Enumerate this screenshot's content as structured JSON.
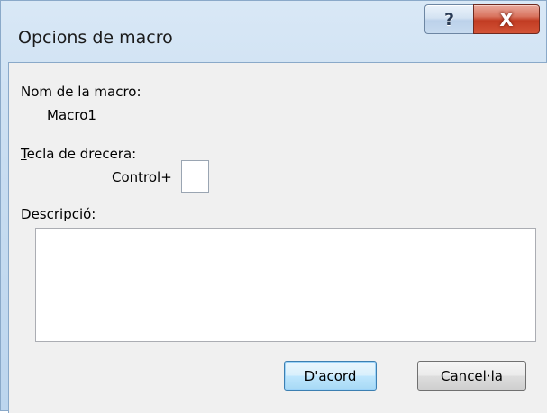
{
  "window": {
    "title": "Opcions de macro",
    "help_glyph": "?",
    "close_glyph": "X"
  },
  "form": {
    "macro_name_label": "Nom de la macro:",
    "macro_name_value": "Macro1",
    "shortcut_label_hotkey": "T",
    "shortcut_label_rest": "ecla de drecera:",
    "shortcut_prefix": "Control+",
    "shortcut_value": "",
    "description_label_hotkey": "D",
    "description_label_rest": "escripció:",
    "description_value": ""
  },
  "buttons": {
    "ok_label": "D'acord",
    "cancel_label": "Cancel·la"
  },
  "colors": {
    "close_button": "#c13b22",
    "default_button_border": "#3c7fb1"
  }
}
